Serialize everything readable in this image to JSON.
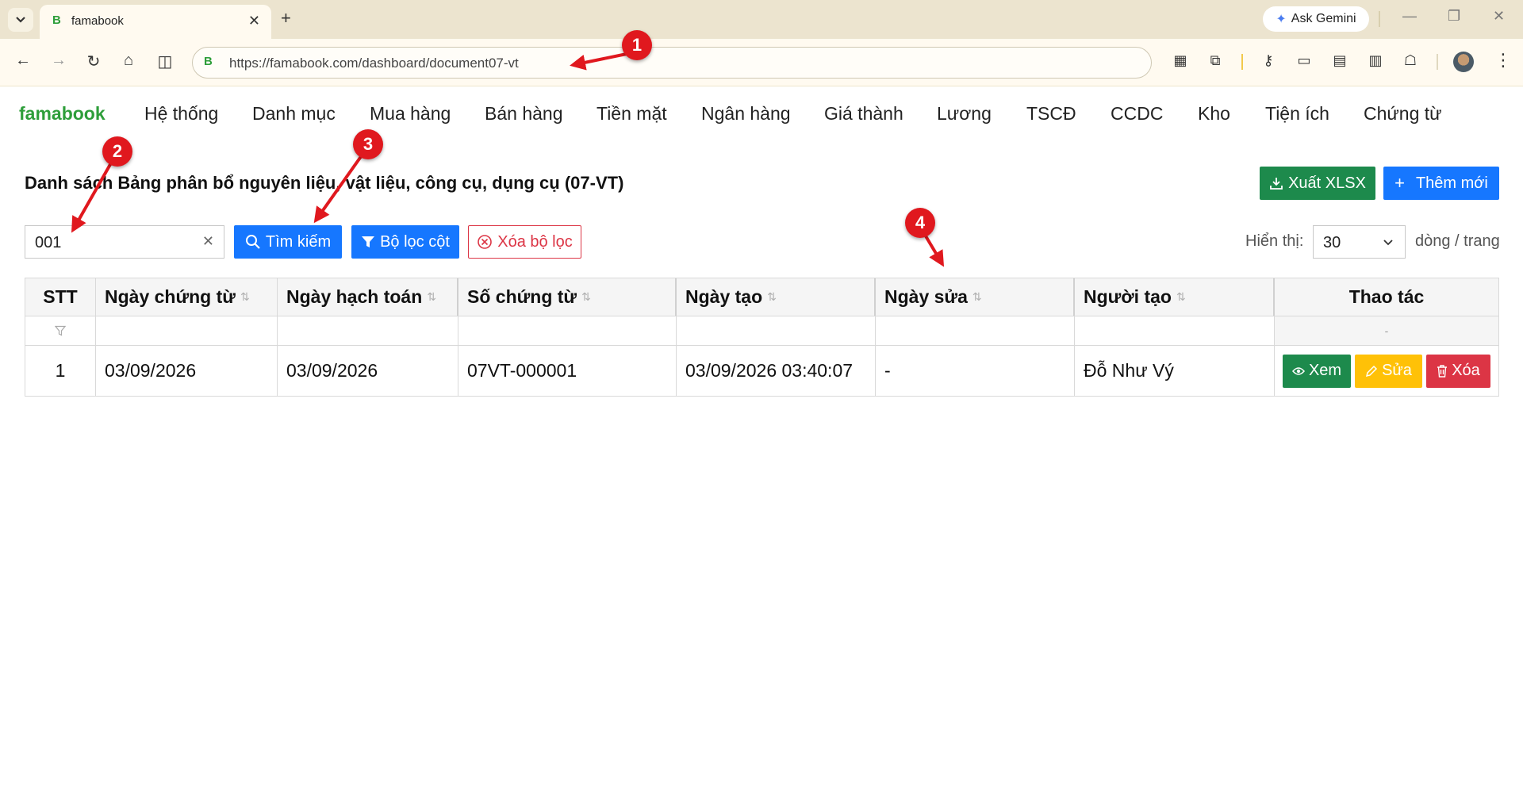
{
  "browser": {
    "tab_favicon": "B",
    "tab_title": "famabook",
    "new_tab_symbol": "+",
    "gemini_label": "Ask Gemini",
    "site_badge": "B",
    "url": "https://famabook.com/dashboard/document07-vt",
    "icons": [
      "tab-menu-icon",
      "back-icon",
      "forward-icon",
      "reload-icon",
      "home-icon",
      "split-view-icon",
      "qr-code-icon",
      "extensions-icon",
      "password-key-icon",
      "payment-card-icon",
      "reading-mode-icon",
      "sidebar-icon",
      "incognito-icon",
      "profile-avatar",
      "more-menu-icon"
    ]
  },
  "nav": {
    "brand": "famabook",
    "items": [
      "Hệ thống",
      "Danh mục",
      "Mua hàng",
      "Bán hàng",
      "Tiền mặt",
      "Ngân hàng",
      "Giá thành",
      "Lương",
      "TSCĐ",
      "CCDC",
      "Kho",
      "Tiện ích",
      "Chứng từ"
    ]
  },
  "page": {
    "title": "Danh sách Bảng phân bổ nguyên liệu, vật liệu, công cụ, dụng cụ (07-VT)",
    "export_label": "Xuất XLSX",
    "add_label": "Thêm mới"
  },
  "filters": {
    "search_value": "001",
    "search_button": "Tìm kiếm",
    "column_filter_button": "Bộ lọc cột",
    "clear_filter_button": "Xóa bộ lọc",
    "show_label": "Hiển thị:",
    "page_size": "30",
    "rows_per_page_label": "dòng / trang"
  },
  "table": {
    "headers": [
      "STT",
      "Ngày chứng từ",
      "Ngày hạch toán",
      "Số chứng từ",
      "Ngày tạo",
      "Ngày sửa",
      "Người tạo",
      "Thao tác"
    ],
    "actions_filter_placeholder": "-",
    "rows": [
      {
        "stt": "1",
        "ngay_chung_tu": "03/09/2026",
        "ngay_hach_toan": "03/09/2026",
        "so_chung_tu": "07VT-000001",
        "ngay_tao": "03/09/2026 03:40:07",
        "ngay_sua": "-",
        "nguoi_tao": "Đỗ Như Vý",
        "actions": {
          "view": "Xem",
          "edit": "Sửa",
          "delete": "Xóa"
        }
      }
    ]
  },
  "annotations": [
    "1",
    "2",
    "3",
    "4"
  ],
  "colors": {
    "brand_green": "#2e9e3a",
    "primary_blue": "#1677ff",
    "success_green": "#1d8a4c",
    "warning_yellow": "#ffc107",
    "danger_red": "#dc3545",
    "annotation_red": "#e0181e"
  }
}
